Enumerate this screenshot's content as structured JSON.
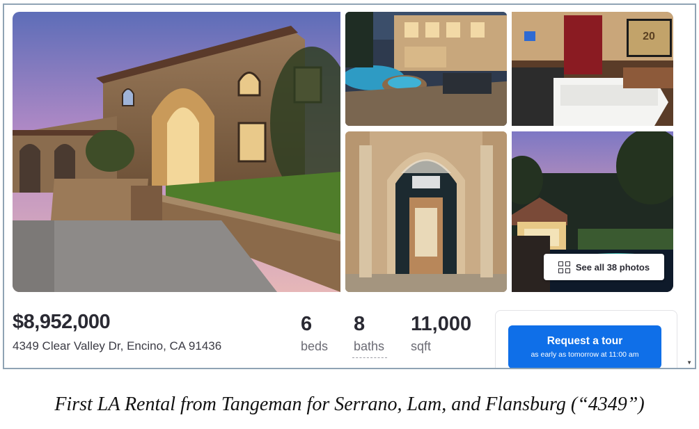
{
  "listing": {
    "price": "$8,952,000",
    "address": "4349 Clear Valley Dr, Encino, CA 91436",
    "beds": {
      "value": "6",
      "label": "beds"
    },
    "baths": {
      "value": "8",
      "label": "baths"
    },
    "sqft": {
      "value": "11,000",
      "label": "sqft"
    }
  },
  "photos": {
    "see_all_label": "See all 38 photos",
    "icon": "grid-icon",
    "items": [
      "house-exterior-photo",
      "pool-patio-photo",
      "home-theater-photo",
      "front-door-photo",
      "night-view-photo"
    ],
    "theater_screen_text": "20"
  },
  "tour": {
    "title": "Request a tour",
    "subtitle": "as early as tomorrow at 11:00 am"
  },
  "caption": "First LA Rental from Tangeman for Serrano, Lam, and Flansburg (“4349”)",
  "colors": {
    "accent": "#0f6fe8",
    "text": "#2a2a33",
    "frame": "#8fa3b4"
  }
}
